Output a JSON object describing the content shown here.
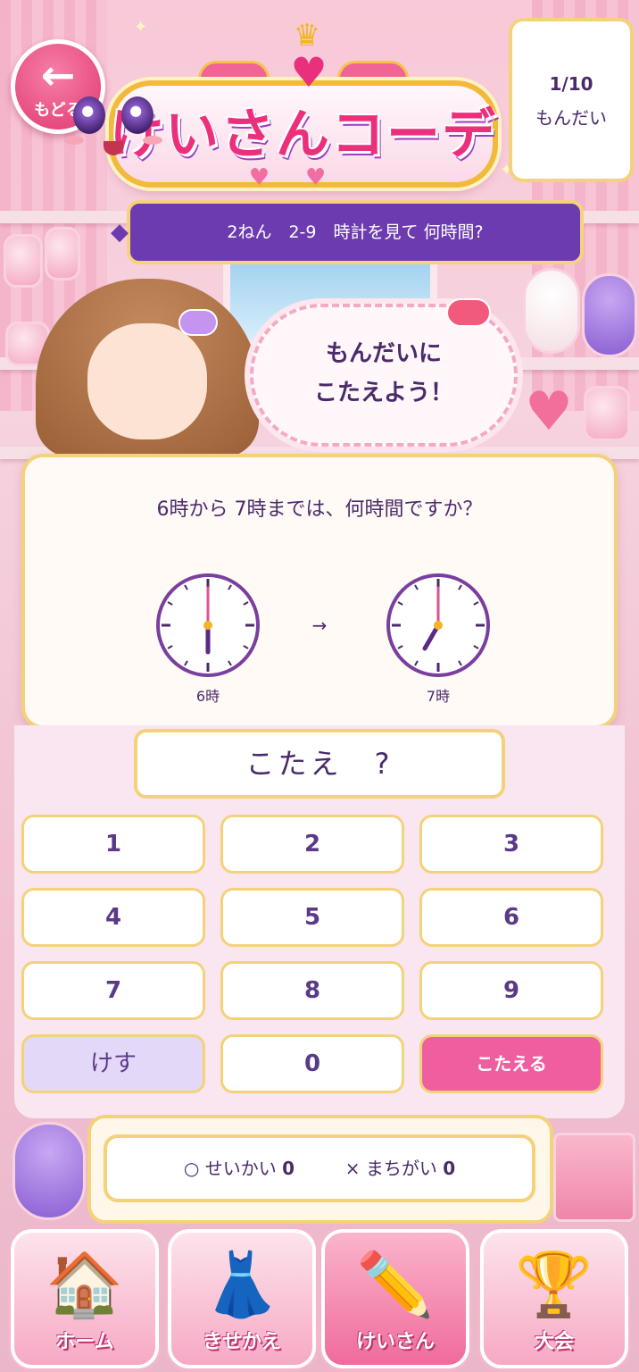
{
  "header": {
    "back_label": "もどる",
    "back_icon": "arrow-left-icon",
    "app_title": "けいさんコーデ"
  },
  "progress": {
    "count": "1/10",
    "label": "もんだい"
  },
  "lesson": {
    "title": "2ねん　2-9　時計を見て 何時間?"
  },
  "speech": {
    "line1": "もんだいに",
    "line2": "こたえよう！"
  },
  "question": {
    "text": "6時から 7時までは、何時間ですか？",
    "arrow": "→",
    "clocks": [
      {
        "label": "6時",
        "hour": 6,
        "minute": 0
      },
      {
        "label": "7時",
        "hour": 7,
        "minute": 0
      }
    ]
  },
  "answer": {
    "display": "こたえ　?"
  },
  "keypad": {
    "keys": [
      "1",
      "2",
      "3",
      "4",
      "5",
      "6",
      "7",
      "8",
      "9"
    ],
    "clear_label": "けす",
    "zero_label": "0",
    "submit_label": "こたえる"
  },
  "score": {
    "correct_label": "○ せいかい",
    "correct_count": "0",
    "wrong_label": "× まちがい",
    "wrong_count": "0"
  },
  "nav": {
    "items": [
      {
        "label": "ホーム",
        "icon": "house-icon"
      },
      {
        "label": "きせかえ",
        "icon": "dress-icon"
      },
      {
        "label": "けいさん",
        "icon": "pencil-icon"
      },
      {
        "label": "大会",
        "icon": "trophy-icon"
      }
    ],
    "active_index": 2
  },
  "colors": {
    "accent": "#ef5f9f",
    "banner": "#6c3bb0",
    "gold_border": "#f3d27a",
    "text": "#4a2a6a"
  }
}
